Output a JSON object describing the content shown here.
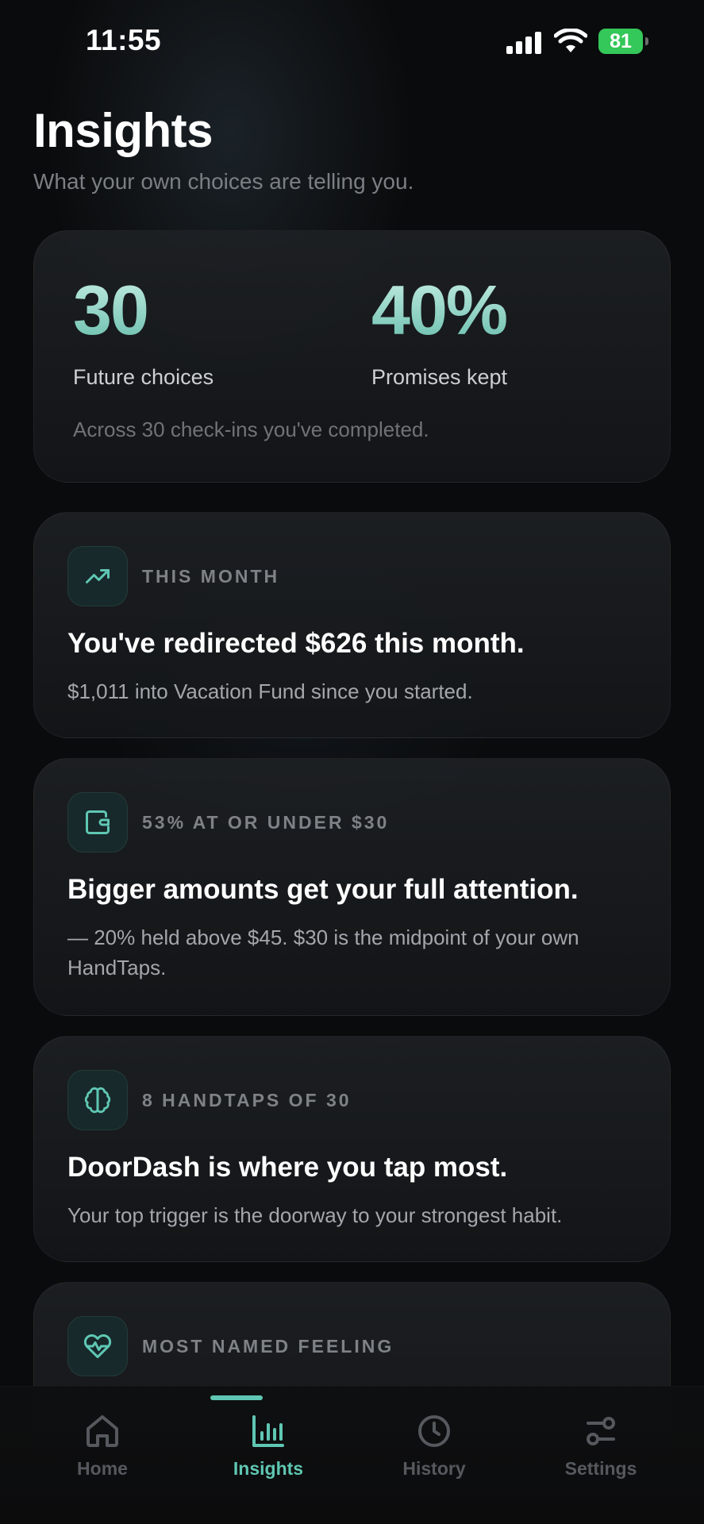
{
  "status_bar": {
    "time": "11:55",
    "battery": "81"
  },
  "header": {
    "title": "Insights",
    "subtitle": "What your own choices are telling you."
  },
  "stats": {
    "future_choices_value": "30",
    "future_choices_label": "Future choices",
    "promises_kept_value": "40%",
    "promises_kept_label": "Promises kept",
    "note": "Across 30 check-ins you've completed."
  },
  "insights": [
    {
      "icon": "trending-up-icon",
      "eyebrow": "THIS MONTH",
      "headline": "You've redirected $626 this month.",
      "body": "$1,011 into Vacation Fund since you started."
    },
    {
      "icon": "wallet-icon",
      "eyebrow": "53% AT OR UNDER $30",
      "headline": "Bigger amounts get your full attention.",
      "body": "— 20% held above $45. $30 is the midpoint of your own HandTaps."
    },
    {
      "icon": "brain-icon",
      "eyebrow": "8 HANDTAPS OF 30",
      "headline": "DoorDash is where you tap most.",
      "body": "Your top trigger is the doorway to your strongest habit."
    },
    {
      "icon": "heart-pulse-icon",
      "eyebrow": "MOST NAMED FEELING",
      "headline": "",
      "body": ""
    }
  ],
  "nav": {
    "items": [
      {
        "label": "Home",
        "icon": "home-icon"
      },
      {
        "label": "Insights",
        "icon": "bar-chart-icon"
      },
      {
        "label": "History",
        "icon": "clock-icon"
      },
      {
        "label": "Settings",
        "icon": "sliders-icon"
      }
    ],
    "active": "Insights"
  },
  "colors": {
    "accent": "#5fc7b3",
    "background": "#0a0b0c",
    "battery": "#34c759"
  }
}
